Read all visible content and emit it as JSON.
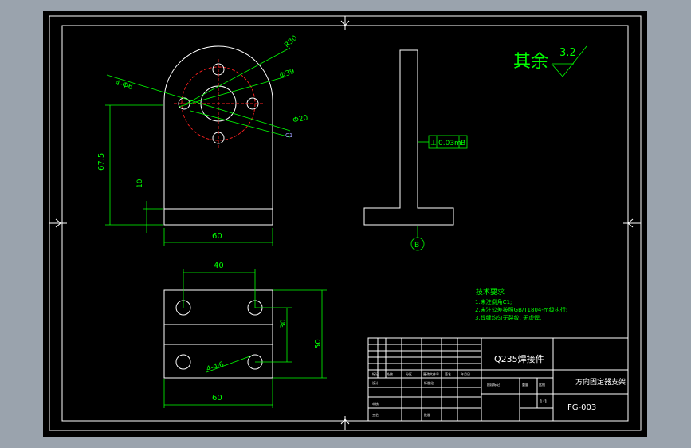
{
  "roughness": {
    "label": "其余",
    "value": "3.2"
  },
  "front_view": {
    "holes_note": "4-Ф6",
    "dia_outer": "R30",
    "dia_pitch": "Ф39",
    "dia_center": "Ф20",
    "chamfer": "C1",
    "height": "67.5",
    "base_thickness": "10",
    "width": "60"
  },
  "side_view": {
    "tolerance_symbol": "⊥",
    "tolerance_value": "0.03m",
    "datum_ref": "B",
    "datum_label": "B"
  },
  "top_view": {
    "spacing_x": "40",
    "spacing_y": "30",
    "depth": "50",
    "width": "60",
    "holes_note": "4-Ф6"
  },
  "tech_notes": {
    "heading": "技术要求",
    "lines": [
      "1.未注倒角C1;",
      "2.未注公差按照GB/T1804-m级执行;",
      "3.焊缝均匀无裂纹, 无虚焊."
    ]
  },
  "title_block": {
    "material": "Q235焊接件",
    "part_name": "方向固定器支架",
    "drawing_no": "FG-003",
    "scale": "1:1",
    "small_labels": [
      "标记",
      "处数",
      "分区",
      "更改文件号",
      "签名",
      "年月日",
      "设计",
      "标准化",
      "阶段标记",
      "重量",
      "比例",
      "审核",
      "工艺",
      "批准"
    ]
  }
}
